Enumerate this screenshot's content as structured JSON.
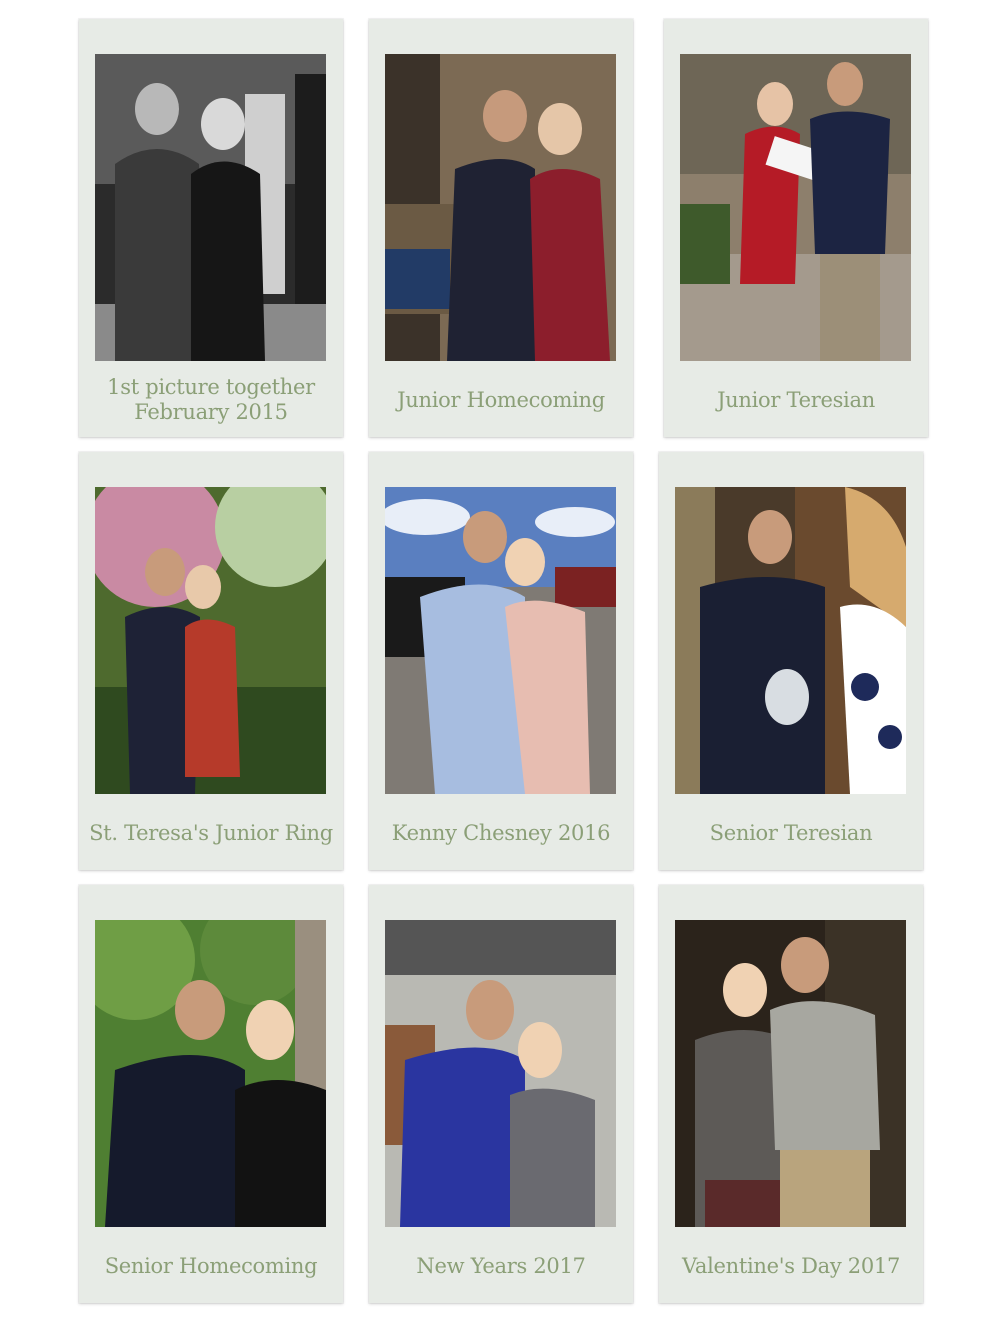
{
  "cards": [
    {
      "caption_line1": "1st picture together",
      "caption_line2": "February 2015",
      "photo": "black-and-white couple indoors"
    },
    {
      "caption_line1": "Junior Homecoming",
      "caption_line2": "",
      "photo": "couple in front of stone wall"
    },
    {
      "caption_line1": "Junior Teresian",
      "caption_line2": "",
      "photo": "couple holding OKTOBER sign"
    },
    {
      "caption_line1": "St. Teresa's Junior Ring",
      "caption_line2": "",
      "photo": "couple under blossoming tree"
    },
    {
      "caption_line1": "Kenny Chesney 2016",
      "caption_line2": "",
      "photo": "couple in parking lot"
    },
    {
      "caption_line1": "Senior Teresian",
      "caption_line2": "",
      "photo": "pinning boutonniere"
    },
    {
      "caption_line1": "Senior Homecoming",
      "caption_line2": "",
      "photo": "couple outdoors in formal wear"
    },
    {
      "caption_line1": "New Years 2017",
      "caption_line2": "",
      "photo": "couple indoors in winter clothes"
    },
    {
      "caption_line1": "Valentine's Day 2017",
      "caption_line2": "",
      "photo": "couple indoors"
    }
  ],
  "colors": {
    "caption": "#8b9f77",
    "frame": "#e7ebe6",
    "background": "#ffffff"
  }
}
